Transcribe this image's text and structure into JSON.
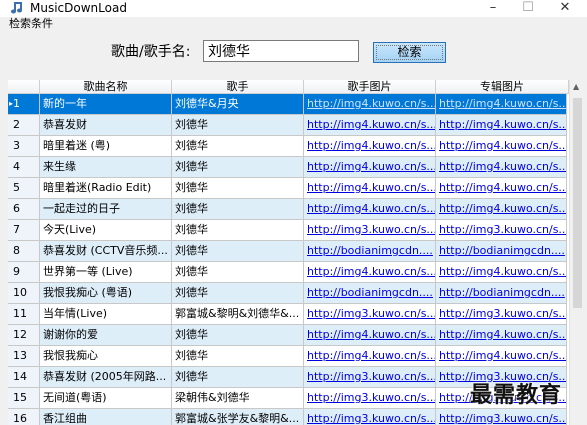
{
  "window": {
    "title": "MusicDownLoad",
    "minimize": "–",
    "maximize": "☐",
    "close": "✕"
  },
  "search": {
    "group_label": "检索条件",
    "label": "歌曲/歌手名:",
    "value": "刘德华",
    "button_label": "检索"
  },
  "grid": {
    "columns": [
      "",
      "歌曲名称",
      "歌手",
      "歌手图片",
      "专辑图片"
    ],
    "selected_row": 1,
    "rows": [
      {
        "num": "1",
        "song": "新的一年",
        "artist": "刘德华&月央",
        "artist_img": "http://img4.kuwo.cn/s...",
        "album_img": "http://img4.kuwo.cn/s..."
      },
      {
        "num": "2",
        "song": "恭喜发财",
        "artist": "刘德华",
        "artist_img": "http://img4.kuwo.cn/s...",
        "album_img": "http://img4.kuwo.cn/s..."
      },
      {
        "num": "3",
        "song": "暗里着迷 (粤)",
        "artist": "刘德华",
        "artist_img": "http://img4.kuwo.cn/s...",
        "album_img": "http://img4.kuwo.cn/s..."
      },
      {
        "num": "4",
        "song": "来生缘",
        "artist": "刘德华",
        "artist_img": "http://img4.kuwo.cn/s...",
        "album_img": "http://img4.kuwo.cn/s..."
      },
      {
        "num": "5",
        "song": "暗里着迷(Radio Edit)",
        "artist": "刘德华",
        "artist_img": "http://img4.kuwo.cn/s...",
        "album_img": "http://img4.kuwo.cn/s..."
      },
      {
        "num": "6",
        "song": "一起走过的日子",
        "artist": "刘德华",
        "artist_img": "http://img4.kuwo.cn/s...",
        "album_img": "http://img4.kuwo.cn/s..."
      },
      {
        "num": "7",
        "song": "今天(Live)",
        "artist": "刘德华",
        "artist_img": "http://img3.kuwo.cn/s...",
        "album_img": "http://img3.kuwo.cn/s..."
      },
      {
        "num": "8",
        "song": "恭喜发财 (CCTV音乐频...",
        "artist": "刘德华",
        "artist_img": "http://bodianimgcdn....",
        "album_img": "http://bodianimgcdn...."
      },
      {
        "num": "9",
        "song": "世界第一等 (Live)",
        "artist": "刘德华",
        "artist_img": "http://img4.kuwo.cn/s...",
        "album_img": "http://img4.kuwo.cn/s..."
      },
      {
        "num": "10",
        "song": "我恨我痴心 (粤语)",
        "artist": "刘德华",
        "artist_img": "http://bodianimgcdn....",
        "album_img": "http://bodianimgcdn...."
      },
      {
        "num": "11",
        "song": "当年情(Live)",
        "artist": "郭富城&黎明&刘德华&...",
        "artist_img": "http://img3.kuwo.cn/s...",
        "album_img": "http://img3.kuwo.cn/s..."
      },
      {
        "num": "12",
        "song": "谢谢你的爱",
        "artist": "刘德华",
        "artist_img": "http://img4.kuwo.cn/s...",
        "album_img": "http://img4.kuwo.cn/s..."
      },
      {
        "num": "13",
        "song": "我恨我痴心",
        "artist": "刘德华",
        "artist_img": "http://img4.kuwo.cn/s...",
        "album_img": "http://img4.kuwo.cn/s..."
      },
      {
        "num": "14",
        "song": "恭喜发财 (2005年网路...",
        "artist": "刘德华",
        "artist_img": "http://img3.kuwo.cn/s...",
        "album_img": "http://img3.kuwo.cn/s..."
      },
      {
        "num": "15",
        "song": "无间道(粤语)",
        "artist": "梁朝伟&刘德华",
        "artist_img": "http://img3.kuwo.cn/s...",
        "album_img": "http://img3.kuwo.cn/s..."
      },
      {
        "num": "16",
        "song": "香江组曲",
        "artist": "郭富城&张学友&黎明&...",
        "artist_img": "http://img3.kuwo.cn/s...",
        "album_img": "http://img3.kuwo.cn/s..."
      }
    ]
  },
  "watermark": "最需教育",
  "colors": {
    "selection": "#0078d7",
    "alt_row": "#deeef9",
    "link": "#0000e0"
  }
}
